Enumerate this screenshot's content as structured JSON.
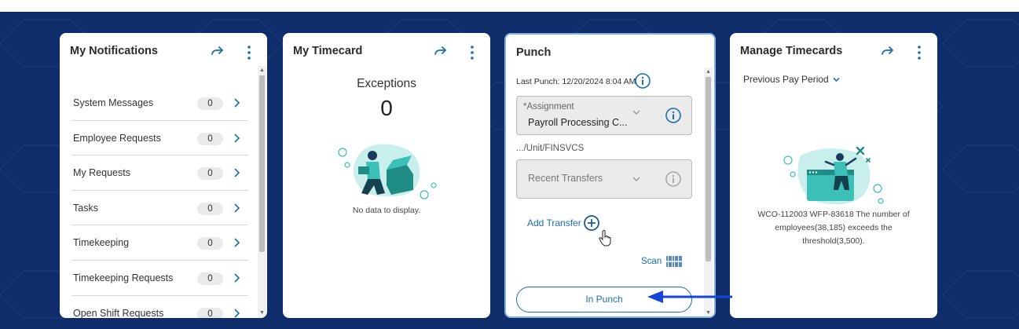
{
  "notifications": {
    "title": "My Notifications",
    "items": [
      {
        "label": "System Messages",
        "count": "0"
      },
      {
        "label": "Employee Requests",
        "count": "0"
      },
      {
        "label": "My Requests",
        "count": "0"
      },
      {
        "label": "Tasks",
        "count": "0"
      },
      {
        "label": "Timekeeping",
        "count": "0"
      },
      {
        "label": "Timekeeping Requests",
        "count": "0"
      },
      {
        "label": "Open Shift Requests",
        "count": "0"
      }
    ]
  },
  "timecard": {
    "title": "My Timecard",
    "exceptions_label": "Exceptions",
    "exceptions_count": "0",
    "empty_text": "No data to display."
  },
  "punch": {
    "title": "Punch",
    "last_punch": "Last Punch: 12/20/2024 8:04 AM",
    "assignment_label": "*Assignment",
    "assignment_value": "Payroll Processing C...",
    "unit_path": ".../Unit/FINSVCS",
    "transfers_placeholder": "Recent Transfers",
    "add_transfer": "Add Transfer",
    "scan": "Scan",
    "in_punch": "In Punch"
  },
  "manage": {
    "title": "Manage Timecards",
    "period": "Previous Pay Period",
    "message": "WCO-112003 WFP-83618 The number of employees(38,185) exceeds the threshold(3,500)."
  },
  "colors": {
    "background": "#0e2d6a",
    "accent": "#1a6fb0",
    "teal": "#3bbfb6",
    "arrow": "#1545d6"
  },
  "icons": {
    "header_go": "arrow-right-icon",
    "header_menu": "kebab-menu-icon",
    "row_chevron": "chevron-right-icon",
    "info": "info-icon",
    "add": "plus-circle-icon",
    "scan": "barcode-icon",
    "dropdown": "chevron-down-icon"
  }
}
